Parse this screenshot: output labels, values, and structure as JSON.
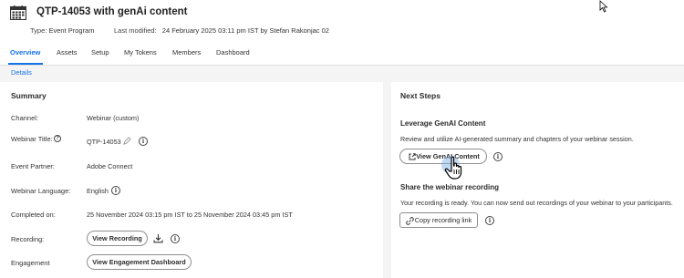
{
  "header": {
    "title": "QTP-14053 with genAi content",
    "type_label": "Type:",
    "type_value": "Event Program",
    "modified_label": "Last modified:",
    "modified_value": "24 February 2025 03:11 pm IST by Stefan Rakonjac 02",
    "icon": "calendar-grid-icon"
  },
  "tabs": [
    {
      "label": "Overview",
      "active": true
    },
    {
      "label": "Assets"
    },
    {
      "label": "Setup"
    },
    {
      "label": "My Tokens"
    },
    {
      "label": "Members"
    },
    {
      "label": "Dashboard"
    }
  ],
  "subnav": {
    "details": "Details"
  },
  "summary": {
    "heading": "Summary",
    "channel_label": "Channel:",
    "channel_value": "Webinar (custom)",
    "webinar_title_label": "Webinar Title:",
    "webinar_title_value": "QTP-14053",
    "event_partner_label": "Event Partner:",
    "event_partner_value": "Adobe Connect",
    "language_label": "Webinar Language:",
    "language_value": "English",
    "completed_label": "Completed on:",
    "completed_value": "25 November 2024 03:15 pm IST to 25 November 2024 03:45 pm IST",
    "recording_label": "Recording:",
    "view_recording": "View Recording",
    "engagement_label": "Engagement",
    "view_engagement": "View Engagement Dashboard"
  },
  "next_steps": {
    "heading": "Next Steps",
    "genai_heading": "Leverage GenAI Content",
    "genai_desc": "Review and utilize AI-generated summary and chapters of your webinar session.",
    "view_genai": "View GenAI Content",
    "share_heading": "Share the webinar recording",
    "share_desc": "Your recording is ready. You can now send out recordings of your webinar to your participants.",
    "copy_link": "Copy recording link"
  },
  "info_glyph": "i",
  "help_glyph": "?",
  "colors": {
    "accent": "#1473e6",
    "background": "#f4f4f4",
    "card": "#ffffff"
  }
}
